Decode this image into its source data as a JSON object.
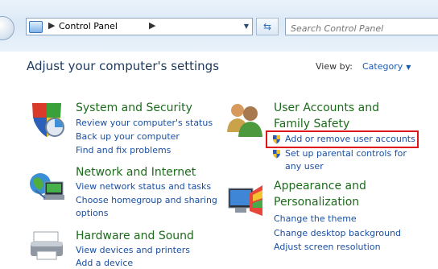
{
  "address_bar": {
    "crumb": "Control Panel"
  },
  "search": {
    "placeholder": "Search Control Panel"
  },
  "header": {
    "title": "Adjust your computer's settings",
    "view_by_label": "View by:",
    "view_by_value": "Category"
  },
  "categories": {
    "system_security": {
      "title": "System and Security",
      "links": [
        "Review your computer's status",
        "Back up your computer",
        "Find and fix problems"
      ]
    },
    "network_internet": {
      "title": "Network and Internet",
      "links": [
        "View network status and tasks",
        "Choose homegroup and sharing",
        "options"
      ]
    },
    "hardware_sound": {
      "title": "Hardware and Sound",
      "links": [
        "View devices and printers"
      ]
    },
    "user_accounts": {
      "title_line1": "User Accounts and",
      "title_line2": "Family Safety",
      "links": [
        "Add or remove user accounts",
        "Set up parental controls for",
        "any user"
      ]
    },
    "appearance": {
      "title_line1": "Appearance and",
      "title_line2": "Personalization",
      "links": [
        "Change the theme",
        "Change desktop background",
        "Adjust screen resolution"
      ]
    }
  },
  "colors": {
    "category_title": "#1c6b1c",
    "link": "#1a4fa3",
    "highlight": "#e0141b"
  },
  "icons": [
    "back-forward-icon",
    "control-panel-icon",
    "refresh-icon",
    "system-security-icon",
    "user-accounts-icon",
    "network-icon",
    "appearance-icon",
    "hardware-icon",
    "uac-shield-icon"
  ]
}
